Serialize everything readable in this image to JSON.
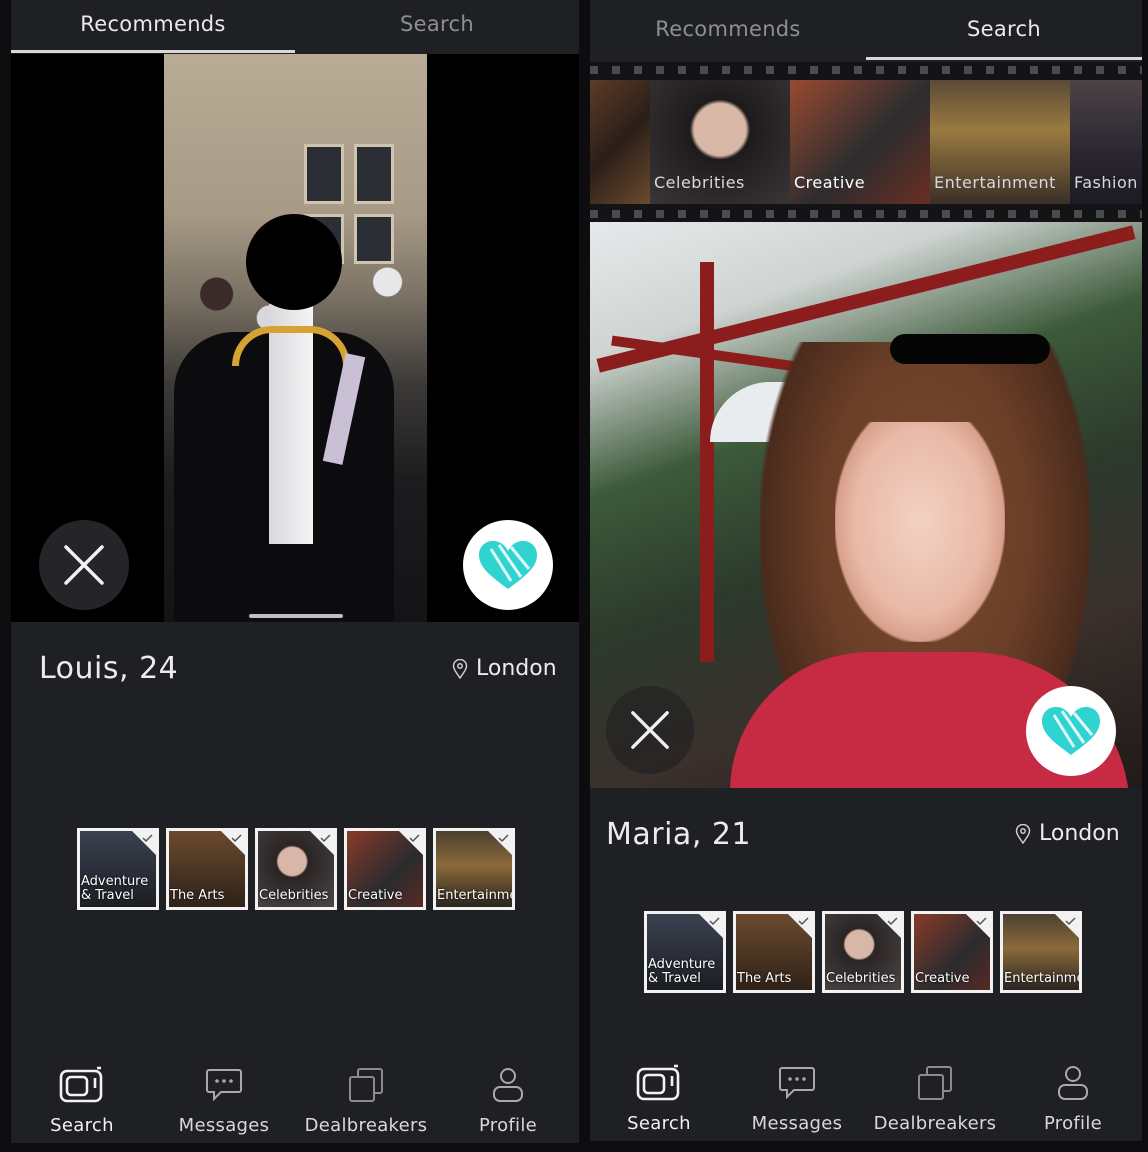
{
  "left": {
    "tabs": [
      {
        "label": "Recommends",
        "active": true
      },
      {
        "label": "Search",
        "active": false
      }
    ],
    "profile": {
      "name_age": "Louis, 24",
      "location": "London"
    },
    "interests": [
      {
        "label_line1": "Adventure",
        "label_line2": "& Travel",
        "color": "#2a2e36"
      },
      {
        "label_line1": "The Arts",
        "label_line2": "",
        "color": "#4a3524"
      },
      {
        "label_line1": "Celebrities",
        "label_line2": "",
        "color": "#3a3434"
      },
      {
        "label_line1": "Creative",
        "label_line2": "",
        "color": "#5a2a22"
      },
      {
        "label_line1": "Entertainme",
        "label_line2": "",
        "color": "#5c4a2e"
      }
    ]
  },
  "right": {
    "tabs": [
      {
        "label": "Recommends",
        "active": false
      },
      {
        "label": "Search",
        "active": true
      }
    ],
    "categories": [
      "Celebrities",
      "Creative",
      "Entertainment",
      "Fashion"
    ],
    "profile": {
      "name_age": "Maria, 21",
      "location": "London"
    },
    "interests": [
      {
        "label_line1": "Adventure",
        "label_line2": "& Travel",
        "color": "#2a2e36"
      },
      {
        "label_line1": "The Arts",
        "label_line2": "",
        "color": "#4a3524"
      },
      {
        "label_line1": "Celebrities",
        "label_line2": "",
        "color": "#3a3434"
      },
      {
        "label_line1": "Creative",
        "label_line2": "",
        "color": "#5a2a22"
      },
      {
        "label_line1": "Entertainme",
        "label_line2": "",
        "color": "#5c4a2e"
      }
    ]
  },
  "nav": [
    {
      "label": "Search",
      "icon": "camera-search-icon"
    },
    {
      "label": "Messages",
      "icon": "chat-bubble-icon"
    },
    {
      "label": "Dealbreakers",
      "icon": "stacked-squares-icon"
    },
    {
      "label": "Profile",
      "icon": "person-icon"
    }
  ],
  "colors": {
    "accent": "#2fd3d0",
    "background": "#1f2023",
    "text": "#ececee"
  }
}
